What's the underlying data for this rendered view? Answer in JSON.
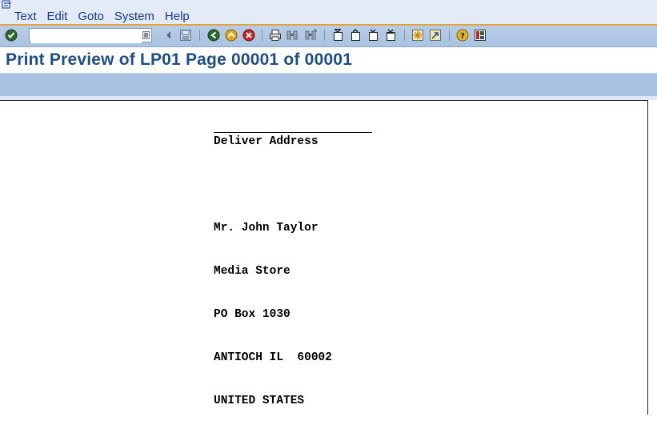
{
  "menubar": {
    "items": [
      "Text",
      "Edit",
      "Goto",
      "System",
      "Help"
    ]
  },
  "toolbar": {
    "command_field_value": "",
    "icons": [
      "enter-icon",
      "dropdown-icon",
      "back-nav-icon",
      "save-icon",
      "back-icon",
      "exit-icon",
      "cancel-icon",
      "print-icon",
      "find-icon",
      "find-next-icon",
      "first-page-icon",
      "previous-page-icon",
      "next-page-icon",
      "last-page-icon",
      "create-session-icon",
      "shortcut-icon",
      "help-icon",
      "customize-layout-icon"
    ]
  },
  "title": {
    "text": "Print Preview of LP01 Page 00001 of 00001"
  },
  "document": {
    "heading": "Deliver Address",
    "lines": [
      "Mr. John Taylor",
      "Media Store",
      "PO Box 1030",
      "ANTIOCH IL  60002",
      "UNITED STATES"
    ]
  },
  "colors": {
    "menubar_bg": "#e3ecf6",
    "menu_text": "#18378d",
    "toolbar_bg": "#b8cde6",
    "accent_line": "#e6a33c",
    "title_text": "#1f4e86",
    "app_toolbar_bg": "#a7c1e0"
  }
}
